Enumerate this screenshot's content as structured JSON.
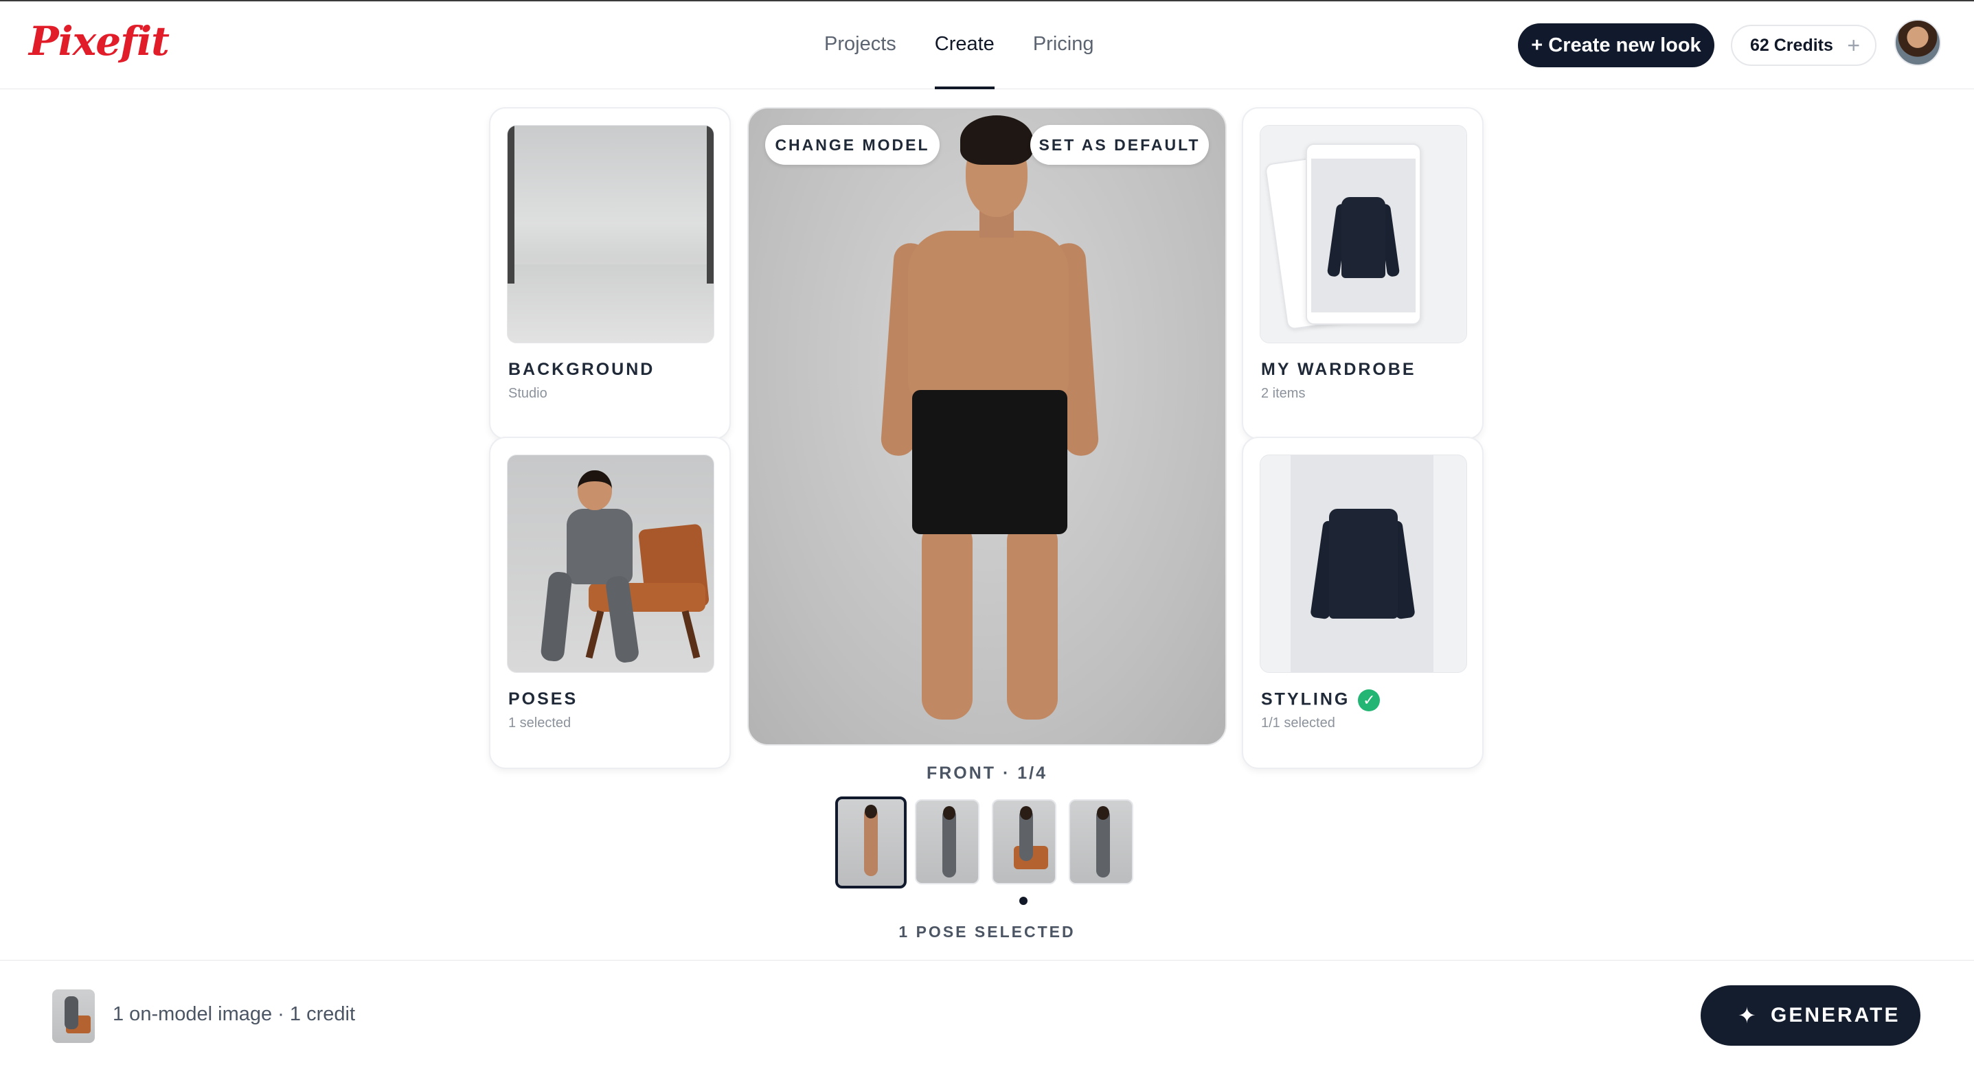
{
  "app": {
    "logo": "Pixefit"
  },
  "nav": [
    {
      "label": "Projects"
    },
    {
      "label": "Create",
      "active": true
    },
    {
      "label": "Pricing"
    }
  ],
  "header": {
    "create_new_look": "+ Create new look",
    "credits": "62 Credits",
    "credits_plus": "+"
  },
  "cards": {
    "background": {
      "title": "BACKGROUND",
      "sub": "Studio"
    },
    "poses": {
      "title": "POSES",
      "sub": "1 selected"
    },
    "wardrobe": {
      "title": "MY WARDROBE",
      "sub": "2 items"
    },
    "styling": {
      "title": "STYLING",
      "sub": "1/1 selected",
      "check": "✓"
    }
  },
  "model": {
    "change_model": "CHANGE MODEL",
    "set_default": "SET AS DEFAULT",
    "view_label": "FRONT · 1/4"
  },
  "poses_selected": "1 POSE SELECTED",
  "footer": {
    "summary": "1 on-model image · 1 credit",
    "generate": "GENERATE",
    "generate_icon": "✦"
  },
  "colors": {
    "brand": "#e11d2a",
    "primary_button": "#111a2c",
    "check": "#22b573"
  }
}
